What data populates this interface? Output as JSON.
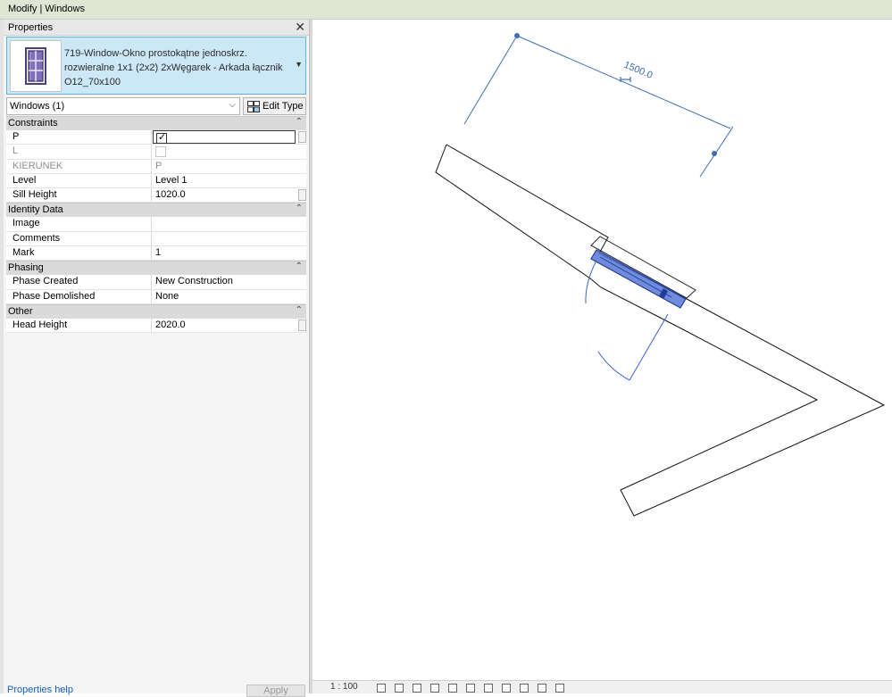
{
  "window": {
    "title": "Modify | Windows"
  },
  "panel": {
    "title": "Properties",
    "close_glyph": "✕",
    "type_selector": {
      "name": "719-Window-Okno prostokątne jednoskrz. rozwieralne 1x1 (2x2) 2xWęgarek - Arkada łącznik O12_70x100",
      "thumbnail_icon": "window-icon",
      "dropdown_glyph": "▼"
    },
    "filter": {
      "value": "Windows (1)",
      "chevron": "⌵"
    },
    "edit_type_label": "Edit Type",
    "collapse_glyph": "⌃",
    "groups": {
      "constraints": {
        "label": "Constraints",
        "rows": [
          {
            "name": "P",
            "checked": true
          },
          {
            "name": "L",
            "checked": false
          },
          {
            "name": "KIERUNEK",
            "value": "P"
          },
          {
            "name": "Level",
            "value": "Level 1"
          },
          {
            "name": "Sill Height",
            "value": "1020.0"
          }
        ]
      },
      "identity": {
        "label": "Identity Data",
        "rows": [
          {
            "name": "Image",
            "value": ""
          },
          {
            "name": "Comments",
            "value": ""
          },
          {
            "name": "Mark",
            "value": "1"
          }
        ]
      },
      "phasing": {
        "label": "Phasing",
        "rows": [
          {
            "name": "Phase Created",
            "value": "New Construction"
          },
          {
            "name": "Phase Demolished",
            "value": "None"
          }
        ]
      },
      "other": {
        "label": "Other",
        "rows": [
          {
            "name": "Head Height",
            "value": "2020.0"
          }
        ]
      }
    },
    "footer": {
      "help_link": "Properties help",
      "apply_label": "Apply"
    }
  },
  "view": {
    "dimension_text": "1500.0",
    "selection_color": "#3d63c9",
    "dimension_color": "#3f6db5",
    "viewbar_scale": "1 : 100"
  }
}
